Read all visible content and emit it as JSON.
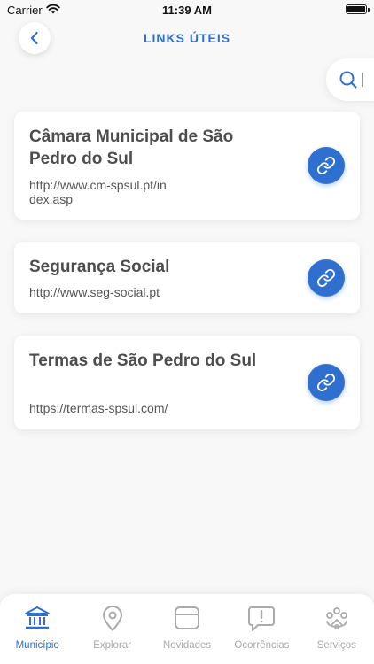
{
  "status_bar": {
    "carrier": "Carrier",
    "time": "11:39 AM"
  },
  "header": {
    "title": "LINKS ÚTEIS"
  },
  "links": [
    {
      "title": "Câmara Municipal de São Pedro do Sul",
      "url": "http://www.cm-spsul.pt/index.asp"
    },
    {
      "title": "Segurança Social",
      "url": "http://www.seg-social.pt"
    },
    {
      "title": "Termas de São Pedro do Sul",
      "url": "https://termas-spsul.com/"
    }
  ],
  "tabs": [
    {
      "label": "Município",
      "icon": "building-columns-icon",
      "active": true
    },
    {
      "label": "Explorar",
      "icon": "map-pin-icon",
      "active": false
    },
    {
      "label": "Novidades",
      "icon": "news-icon",
      "active": false
    },
    {
      "label": "Ocorrências",
      "icon": "alert-message-icon",
      "active": false
    },
    {
      "label": "Serviços",
      "icon": "services-icon",
      "active": false
    }
  ],
  "colors": {
    "accent": "#2f6fd0",
    "inactive": "#aaaaaa",
    "text": "#4d4d4d",
    "background": "#f8f8f8"
  }
}
